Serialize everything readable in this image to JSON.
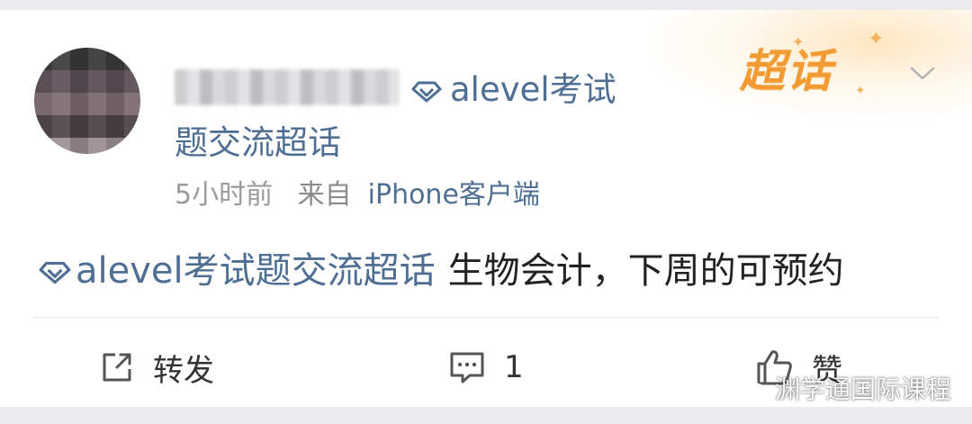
{
  "post": {
    "username_blurred": "",
    "topic_name_line1": "alevel考试",
    "topic_name_line2": "题交流超话",
    "time": "5小时前",
    "source_prefix": "来自",
    "source_device": "iPhone客户端",
    "badge": "超话",
    "content_tag": "alevel考试题交流超话",
    "content_text": "生物会计，下周的可预约"
  },
  "actions": {
    "repost_label": "转发",
    "comment_count": "1",
    "like_label": "赞"
  },
  "watermark": "渊学通国际课程",
  "colors": {
    "link": "#4f6e94",
    "badge": "#f29a33",
    "background": "#ebebee"
  }
}
